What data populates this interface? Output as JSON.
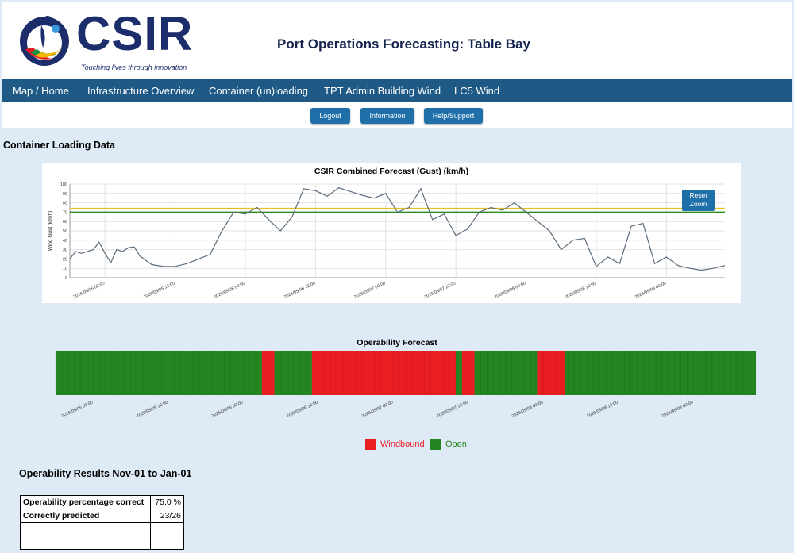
{
  "header": {
    "logo_text": "CSIR",
    "logo_tagline": "Touching lives through innovation",
    "title": "Port Operations Forecasting: Table Bay"
  },
  "nav": {
    "items": [
      {
        "label": "Map / Home"
      },
      {
        "label": "Infrastructure Overview"
      },
      {
        "label": "Container (un)loading"
      },
      {
        "label": "TPT Admin Building Wind"
      },
      {
        "label": "LC5 Wind"
      }
    ]
  },
  "buttons": {
    "logout": "Logout",
    "information": "Information",
    "help": "Help/Support"
  },
  "section_title": "Container Loading Data",
  "chart": {
    "reset_zoom": "Reset Zoom"
  },
  "chart_data": [
    {
      "type": "line",
      "title": "CSIR Combined Forecast (Gust) (km/h)",
      "ylabel": "Wind Gust (km/h)",
      "xlabel": "",
      "ylim": [
        0,
        100
      ],
      "yticks": [
        0,
        10,
        20,
        30,
        40,
        50,
        60,
        70,
        80,
        90,
        100
      ],
      "xticks": [
        "2026/05/05 00:00",
        "2026/05/05 12:00",
        "2026/05/06 00:00",
        "2026/05/06 12:00",
        "2026/05/07 00:00",
        "2026/05/07 12:00",
        "2026/05/08 00:00",
        "2026/05/08 12:00",
        "2026/05/09 00:00"
      ],
      "x_range_hours": [
        -6,
        106
      ],
      "grid": true,
      "thresholds": [
        {
          "value": 74,
          "color": "#e8c21a"
        },
        {
          "value": 70,
          "color": "#2e8b22"
        }
      ],
      "series": [
        {
          "color": "#5a6b7c",
          "x": [
            -6,
            -5,
            -4,
            -3,
            -2,
            -1,
            0,
            1,
            2,
            3,
            4,
            5,
            6,
            8,
            10,
            12,
            14,
            16,
            18,
            20,
            22,
            24,
            26,
            28,
            30,
            32,
            34,
            36,
            38,
            40,
            42,
            44,
            46,
            48,
            50,
            52,
            54,
            56,
            58,
            60,
            62,
            64,
            66,
            68,
            70,
            72,
            74,
            76,
            78,
            80,
            82,
            84,
            86,
            88,
            90,
            92,
            94,
            96,
            98,
            100,
            102,
            104,
            106
          ],
          "y": [
            20,
            28,
            26,
            28,
            30,
            38,
            26,
            16,
            30,
            28,
            32,
            33,
            23,
            14,
            12,
            12,
            15,
            20,
            25,
            50,
            70,
            68,
            75,
            62,
            50,
            65,
            95,
            93,
            87,
            96,
            92,
            88,
            85,
            90,
            70,
            75,
            95,
            62,
            68,
            45,
            52,
            70,
            75,
            72,
            80,
            70,
            60,
            50,
            30,
            40,
            42,
            12,
            22,
            15,
            55,
            58,
            15,
            22,
            13,
            10,
            8,
            10,
            13
          ]
        }
      ]
    },
    {
      "type": "heatmap",
      "title": "Operability Forecast",
      "xticks": [
        "2026/05/05 00:00",
        "2026/05/05 12:00",
        "2026/05/06 00:00",
        "2026/05/06 12:00",
        "2026/05/07 00:00",
        "2026/05/07 12:00",
        "2026/05/08 00:00",
        "2026/05/08 12:00",
        "2026/05/09 00:00"
      ],
      "x_range_hours": [
        -6,
        106
      ],
      "legend": [
        {
          "label": "Windbound",
          "color": "#ea1d23"
        },
        {
          "label": "Open",
          "color": "#23851f"
        }
      ],
      "segments": [
        {
          "start": -6,
          "end": 27,
          "state": "Open"
        },
        {
          "start": 27,
          "end": 29,
          "state": "Windbound"
        },
        {
          "start": 29,
          "end": 35,
          "state": "Open"
        },
        {
          "start": 35,
          "end": 58,
          "state": "Windbound"
        },
        {
          "start": 58,
          "end": 59,
          "state": "Open"
        },
        {
          "start": 59,
          "end": 61,
          "state": "Windbound"
        },
        {
          "start": 61,
          "end": 71,
          "state": "Open"
        },
        {
          "start": 71,
          "end": 75.5,
          "state": "Windbound"
        },
        {
          "start": 75.5,
          "end": 106,
          "state": "Open"
        }
      ]
    }
  ],
  "results": {
    "title": "Operability Results Nov-01 to Jan-01",
    "rows": [
      {
        "label": "Operability percentage correct",
        "value": "75.0 %"
      },
      {
        "label": "Correctly predicted",
        "value": "23/26"
      },
      {
        "label": "",
        "value": ""
      },
      {
        "label": "",
        "value": ""
      }
    ]
  }
}
